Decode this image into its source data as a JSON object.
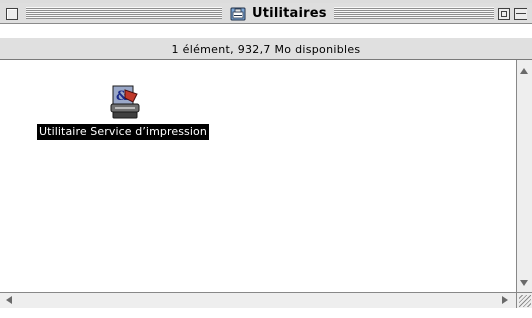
{
  "window": {
    "title": "Utilitaires",
    "title_icon": "folder-printer-icon"
  },
  "info_bar": {
    "text": "1 élément, 932,7  Mo disponibles"
  },
  "items": [
    {
      "label": "Utilitaire Service d’impression",
      "icon": "print-service-icon",
      "selected": true
    }
  ],
  "colors": {
    "selection_bg": "#000000",
    "selection_fg": "#ffffff",
    "chrome": "#dedede"
  }
}
